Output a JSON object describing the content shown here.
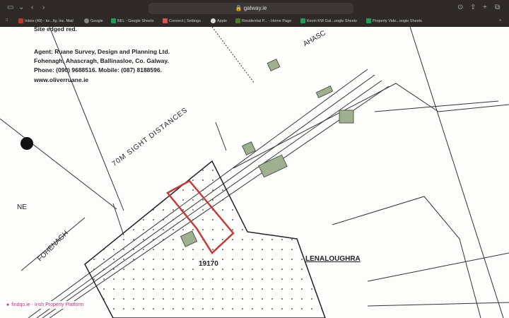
{
  "browser": {
    "url": "galway.ie"
  },
  "bookmarks": [
    {
      "label": "Inbox (49) - ke...lty, Inc. Mail",
      "color": "#c0392b"
    },
    {
      "label": "Google",
      "color": "#888"
    },
    {
      "label": "BEL - Google Sheets",
      "color": "#1e9e5a"
    },
    {
      "label": "Connect | Settings",
      "color": "#d9534f"
    },
    {
      "label": "Apple",
      "color": "#ddd"
    },
    {
      "label": "Residential P... - Home Page",
      "color": "#4a7a2a"
    },
    {
      "label": "Kevin KW Gal...oogle Sheets",
      "color": "#1e9e5a"
    },
    {
      "label": "Property Vide...oogle Sheets",
      "color": "#1e9e5a"
    }
  ],
  "document": {
    "site_note": "Site edged red.",
    "agent": "Agent: Ruane Survey, Design and Planning Ltd.",
    "address": "Fohenagh, Ahascragh, Ballinasloe, Co. Galway.",
    "phone": "Phone: (090) 9688516.    Mobile: (087) 8188596.",
    "web": "www.oliverruane.ie"
  },
  "map": {
    "sight": "70M SIGHT DISTANCES",
    "fohenagh": "FOHENAGH",
    "ahasc": "AHASC",
    "ne": "NE",
    "parcel": "19170",
    "townland": "LENALOUGHRA"
  },
  "footer": {
    "label": "findqo.ie - Irish Property Platform"
  }
}
